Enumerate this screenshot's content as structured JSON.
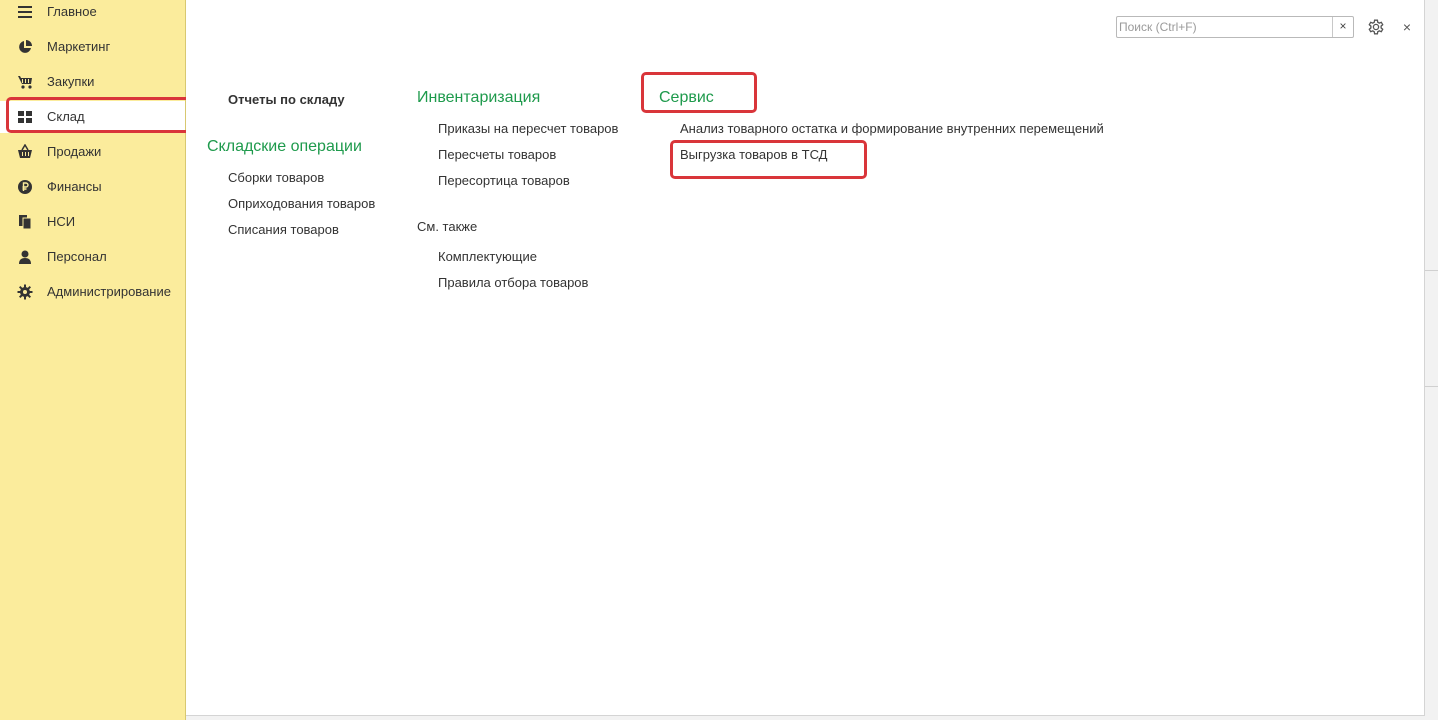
{
  "sidebar": {
    "items": [
      {
        "label": "Главное",
        "icon": "menu-icon"
      },
      {
        "label": "Маркетинг",
        "icon": "pie-chart-icon"
      },
      {
        "label": "Закупки",
        "icon": "cart-icon"
      },
      {
        "label": "Склад",
        "icon": "warehouse-grid-icon"
      },
      {
        "label": "Продажи",
        "icon": "basket-icon"
      },
      {
        "label": "Финансы",
        "icon": "ruble-coin-icon"
      },
      {
        "label": "НСИ",
        "icon": "documents-icon"
      },
      {
        "label": "Персонал",
        "icon": "person-icon"
      },
      {
        "label": "Администрирование",
        "icon": "gear-icon"
      }
    ],
    "active_index": 3
  },
  "search": {
    "placeholder": "Поиск (Ctrl+F)",
    "clear_label": "×"
  },
  "header": {
    "close_label": "×"
  },
  "sections": {
    "col1": {
      "reports_title": "Отчеты по складу",
      "group_title": "Складские операции",
      "links": [
        "Сборки товаров",
        "Оприходования товаров",
        "Списания товаров"
      ]
    },
    "col2": {
      "group_title": "Инвентаризация",
      "links": [
        "Приказы на пересчет товаров",
        "Пересчеты товаров",
        "Пересортица товаров"
      ],
      "see_also_title": "См. также",
      "see_also_links": [
        "Комплектующие",
        "Правила отбора товаров"
      ]
    },
    "col3": {
      "group_title": "Сервис",
      "links": [
        "Анализ товарного остатка и формирование внутренних перемещений",
        "Выгрузка товаров в ТСД"
      ]
    }
  },
  "colors": {
    "sidebar_bg": "#fbec9c",
    "group_title": "#1e9a4c",
    "highlight": "#d9353a"
  }
}
